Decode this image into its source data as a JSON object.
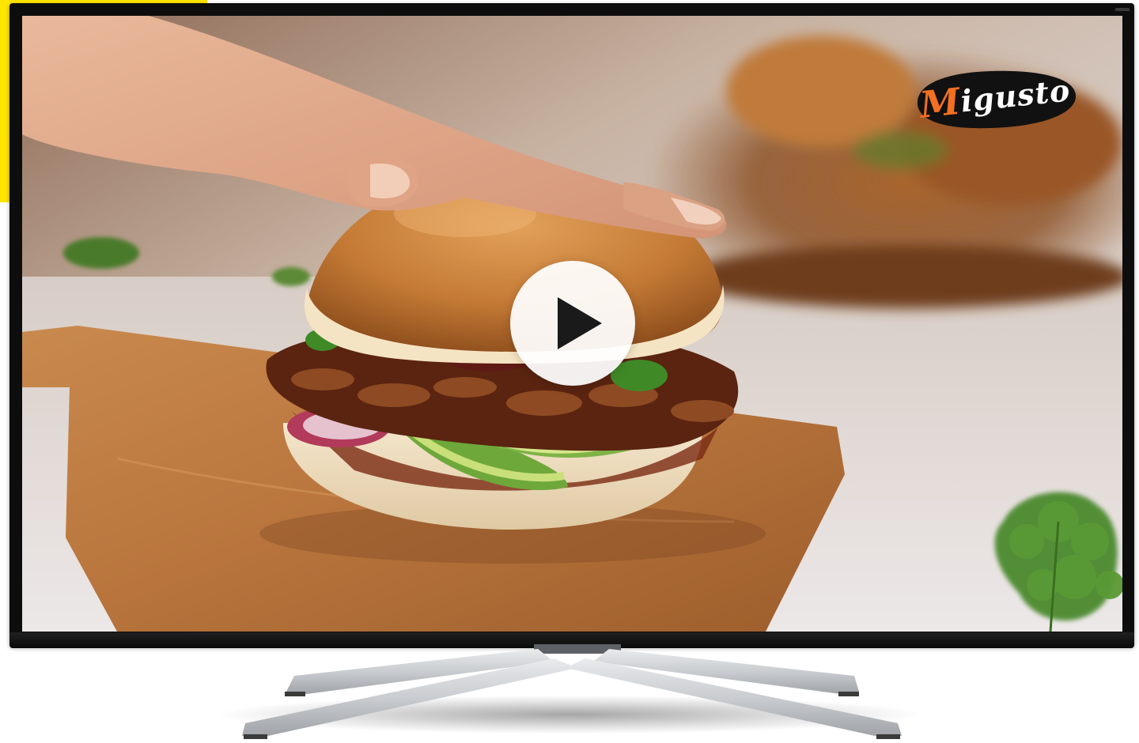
{
  "video": {
    "brand_logo_prefix": "M",
    "brand_logo_rest": "igusto",
    "play_icon": "play-icon",
    "content": "burger-on-wooden-board"
  },
  "colors": {
    "accent_yellow": "#ffe500",
    "logo_orange": "#f36f21",
    "logo_background": "#111111",
    "tv_frame": "#0d0d0d",
    "stand_silver": "#c9ccd0"
  }
}
